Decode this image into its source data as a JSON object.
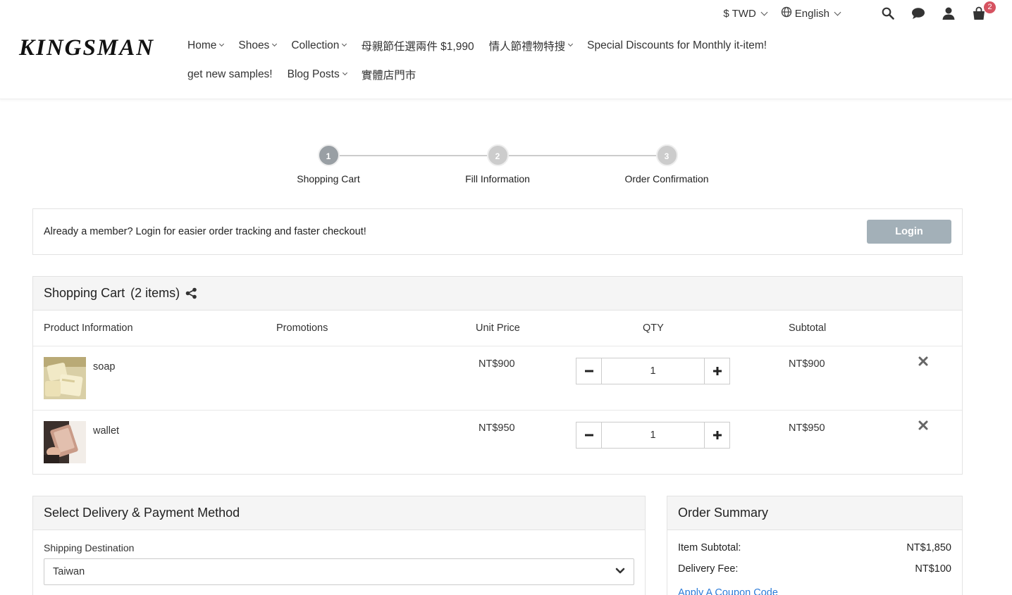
{
  "brand": {
    "logo": "KINGSMAN"
  },
  "topbar": {
    "currency": "$ TWD",
    "language": "English",
    "cart_count": "2"
  },
  "nav": {
    "row1": [
      "Home",
      "Shoes",
      "Collection",
      "母親節任選兩件 $1,990",
      "情人節禮物特搜",
      "Special Discounts for Monthly it-item!"
    ],
    "row2": [
      "get new samples!",
      "Blog Posts",
      "實體店門市"
    ]
  },
  "stepper": {
    "steps": [
      {
        "num": "1",
        "label": "Shopping Cart"
      },
      {
        "num": "2",
        "label": "Fill Information"
      },
      {
        "num": "3",
        "label": "Order Confirmation"
      }
    ],
    "active": 1
  },
  "member": {
    "text": "Already a member? Login for easier order tracking and faster checkout!",
    "login_label": "Login"
  },
  "cart": {
    "title": "Shopping Cart",
    "count_label": "(2 items)",
    "columns": {
      "product": "Product Information",
      "promotions": "Promotions",
      "unit_price": "Unit Price",
      "qty": "QTY",
      "subtotal": "Subtotal"
    },
    "items": [
      {
        "name": "soap",
        "unit_price": "NT$900",
        "qty": "1",
        "subtotal": "NT$900"
      },
      {
        "name": "wallet",
        "unit_price": "NT$950",
        "qty": "1",
        "subtotal": "NT$950"
      }
    ]
  },
  "delivery": {
    "title": "Select Delivery & Payment Method",
    "shipping_label": "Shipping Destination",
    "shipping_value": "Taiwan"
  },
  "summary": {
    "title": "Order Summary",
    "item_subtotal_label": "Item Subtotal:",
    "item_subtotal_value": "NT$1,850",
    "delivery_fee_label": "Delivery Fee:",
    "delivery_fee_value": "NT$100",
    "coupon_link": "Apply A Coupon Code"
  },
  "colors": {
    "badge": "#d65361",
    "login_button": "#a3b0b8",
    "link": "#2b7bd8",
    "step_active": "#999fa4"
  }
}
